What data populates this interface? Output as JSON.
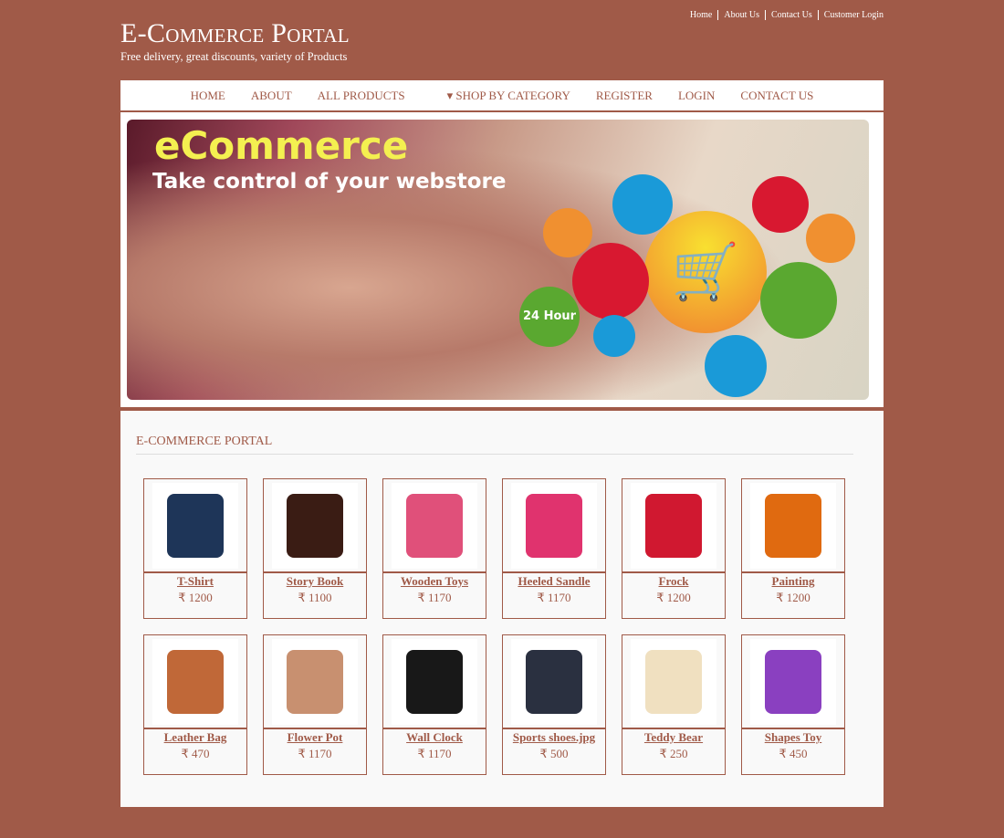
{
  "top_links": [
    "Home",
    "About Us",
    "Contact Us",
    "Customer Login"
  ],
  "brand": {
    "title": "E-Commerce Portal",
    "tagline": "Free delivery, great discounts, variety of Products"
  },
  "nav": [
    "HOME",
    "ABOUT",
    "ALL PRODUCTS",
    "▾ SHOP BY CATEGORY",
    "REGISTER",
    "LOGIN",
    "CONTACT US"
  ],
  "banner": {
    "title": "eCommerce",
    "subtitle": "Take control of your webstore",
    "badge": "24 Hour"
  },
  "section_title": "E-COMMERCE PORTAL",
  "currency": "₹",
  "products": [
    {
      "name": "T-Shirt",
      "price": "₹ 1200",
      "color": "#1e3558"
    },
    {
      "name": "Story Book",
      "price": "₹ 1100",
      "color": "#3a1c14"
    },
    {
      "name": "Wooden Toys",
      "price": "₹ 1170",
      "color": "#e0507a"
    },
    {
      "name": "Heeled Sandle",
      "price": "₹ 1170",
      "color": "#e0336e"
    },
    {
      "name": "Frock",
      "price": "₹ 1200",
      "color": "#d01830"
    },
    {
      "name": "Painting",
      "price": "₹ 1200",
      "color": "#e06a10"
    },
    {
      "name": "Leather Bag",
      "price": "₹ 470",
      "color": "#c06838"
    },
    {
      "name": "Flower Pot",
      "price": "₹ 1170",
      "color": "#c89070"
    },
    {
      "name": "Wall Clock",
      "price": "₹ 1170",
      "color": "#181818"
    },
    {
      "name": "Sports shoes.jpg",
      "price": "₹ 500",
      "color": "#2a3040"
    },
    {
      "name": "Teddy Bear",
      "price": "₹ 250",
      "color": "#f0e0c0"
    },
    {
      "name": "Shapes Toy",
      "price": "₹ 450",
      "color": "#8a40c0"
    }
  ]
}
